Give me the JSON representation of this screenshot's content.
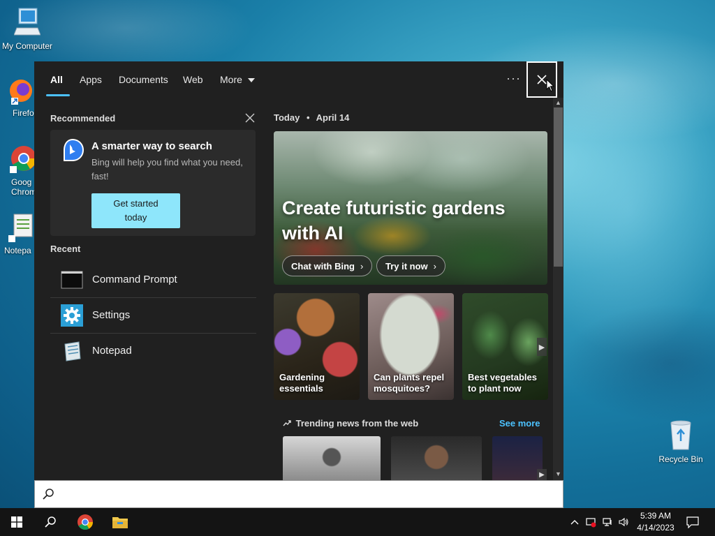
{
  "desktop": {
    "icons": [
      {
        "label": "My Computer"
      },
      {
        "label": "Firefo"
      },
      {
        "label": "Goog\nChrom"
      },
      {
        "label": "Notepa"
      },
      {
        "label": "Recycle Bin"
      }
    ]
  },
  "search_panel": {
    "tabs": [
      {
        "label": "All",
        "active": true
      },
      {
        "label": "Apps"
      },
      {
        "label": "Documents"
      },
      {
        "label": "Web"
      },
      {
        "label": "More"
      }
    ],
    "more_dots": "···",
    "recommended": {
      "title": "Recommended",
      "heading": "A smarter way to search",
      "subtext": "Bing will help you find what you need, fast!",
      "button": "Get started today"
    },
    "recent": {
      "title": "Recent",
      "items": [
        {
          "label": "Command Prompt",
          "icon": "command-prompt-icon"
        },
        {
          "label": "Settings",
          "icon": "settings-gear-icon"
        },
        {
          "label": "Notepad",
          "icon": "notepad-icon"
        }
      ]
    },
    "today": {
      "label": "Today",
      "date": "April 14",
      "hero_title": "Create futuristic gardens with AI",
      "buttons": [
        "Chat with Bing",
        "Try it now"
      ]
    },
    "cards": [
      {
        "caption": "Gardening essentials"
      },
      {
        "caption": "Can plants repel mosquitoes?"
      },
      {
        "caption": "Best vegetables to plant now"
      }
    ],
    "trending": {
      "title": "Trending news from the web",
      "see_more": "See more"
    }
  },
  "search_bar": {
    "value": "",
    "placeholder": ""
  },
  "taskbar": {
    "clock_time": "5:39 AM",
    "clock_date": "4/14/2023"
  },
  "colors": {
    "accent": "#4cc2ff",
    "panel_bg": "#202020",
    "button_bg": "#8ee6fb",
    "taskbar_bg": "#141414"
  }
}
